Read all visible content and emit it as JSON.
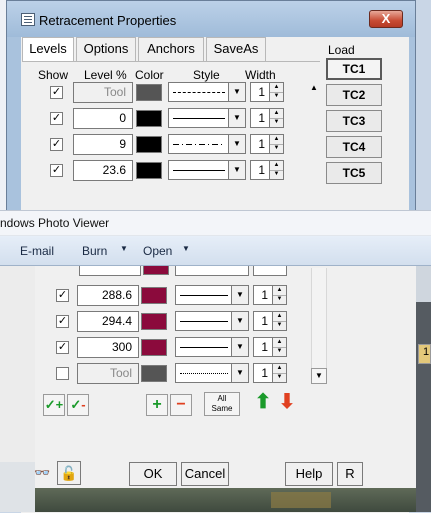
{
  "dialog": {
    "title": "Retracement Properties",
    "close_glyph": "X",
    "tabs": [
      "Levels",
      "Options",
      "Anchors",
      "SaveAs"
    ],
    "active_tab": "Levels",
    "headers": {
      "show": "Show",
      "level": "Level %",
      "color": "Color",
      "style": "Style",
      "width": "Width"
    },
    "load_label": "Load",
    "load_buttons": [
      "TC1",
      "TC2",
      "TC3",
      "TC4",
      "TC5"
    ],
    "selected_load": "TC1",
    "rows_top": [
      {
        "checked": true,
        "level": "Tool",
        "disabled": true,
        "color": "#555555",
        "style": "dashed",
        "width": "1"
      },
      {
        "checked": true,
        "level": "0",
        "disabled": false,
        "color": "#000000",
        "style": "solid",
        "width": "1"
      },
      {
        "checked": true,
        "level": "9",
        "disabled": false,
        "color": "#000000",
        "style": "dash-dot",
        "width": "1"
      },
      {
        "checked": true,
        "level": "23.6",
        "disabled": false,
        "color": "#000000",
        "style": "solid",
        "width": "1"
      }
    ],
    "rows_bottom": [
      {
        "checked": true,
        "level": "288.6",
        "disabled": false,
        "color": "#8b0a3c",
        "style": "solid",
        "width": "1"
      },
      {
        "checked": true,
        "level": "294.4",
        "disabled": false,
        "color": "#8b0a3c",
        "style": "solid",
        "width": "1"
      },
      {
        "checked": true,
        "level": "300",
        "disabled": false,
        "color": "#8b0a3c",
        "style": "solid",
        "width": "1"
      },
      {
        "checked": false,
        "level": "Tool",
        "disabled": true,
        "color": "#555555",
        "style": "dotted",
        "width": "1"
      }
    ],
    "tool_buttons": {
      "all_same_line1": "All",
      "all_same_line2": "Same"
    },
    "buttons": {
      "ok": "OK",
      "cancel": "Cancel",
      "help": "Help",
      "r": "R"
    }
  },
  "photo_viewer": {
    "title": "ndows Photo Viewer",
    "menu": [
      {
        "label": "E-mail",
        "caret": false
      },
      {
        "label": "Burn",
        "caret": true
      },
      {
        "label": "Open",
        "caret": true
      }
    ],
    "right_value": "1"
  },
  "colors": {
    "green_action": "#1a9a2a",
    "red_action": "#e04020",
    "maroon_swatch": "#8b0a3c",
    "title_bar": "#a9c2dd"
  }
}
